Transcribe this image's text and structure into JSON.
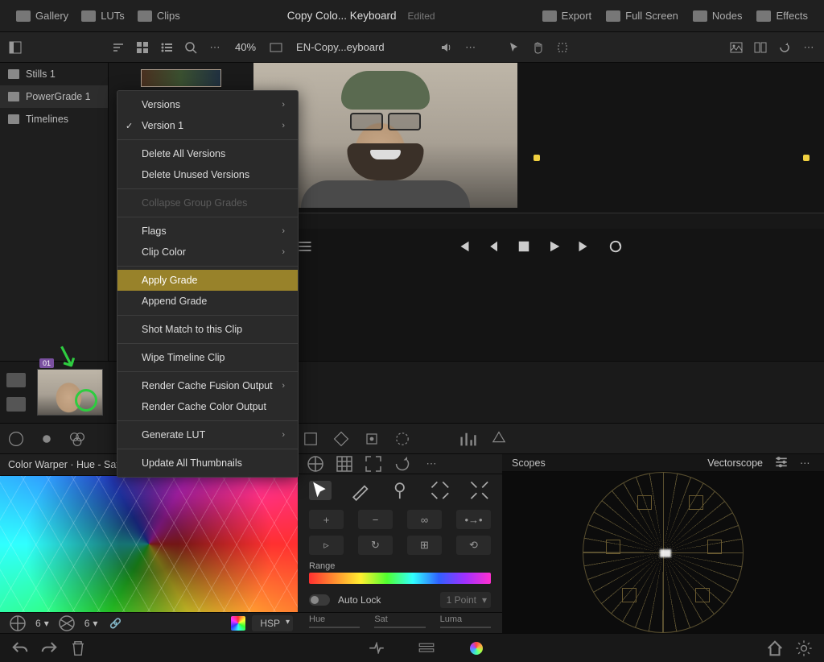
{
  "top": {
    "gallery": "Gallery",
    "luts": "LUTs",
    "clips": "Clips",
    "title": "Copy Colo... Keyboard",
    "edited": "Edited",
    "export": "Export",
    "fullscreen": "Full Screen",
    "nodes": "Nodes",
    "effects": "Effects"
  },
  "toolbar": {
    "zoom": "40%",
    "clipname": "EN-Copy...eyboard"
  },
  "sidebar": {
    "items": [
      {
        "label": "Stills 1"
      },
      {
        "label": "PowerGrade 1"
      },
      {
        "label": "Timelines"
      }
    ]
  },
  "clip": {
    "badge": "01"
  },
  "warper": {
    "title": "Color Warper · Hue - Satu"
  },
  "warper_ctrl": {
    "range_label": "Range",
    "autolock": "Auto Lock",
    "point_sel": "1 Point",
    "sliders": [
      "Hue",
      "Sat",
      "Luma"
    ]
  },
  "scopes": {
    "title": "Scopes",
    "name": "Vectorscope"
  },
  "footer": {
    "num1": "6",
    "num2": "6",
    "mode": "HSP"
  },
  "ctx": {
    "versions": "Versions",
    "version1": "Version 1",
    "delete_all": "Delete All Versions",
    "delete_unused": "Delete Unused Versions",
    "collapse": "Collapse Group Grades",
    "flags": "Flags",
    "clip_color": "Clip Color",
    "apply_grade": "Apply Grade",
    "append_grade": "Append Grade",
    "shot_match": "Shot Match to this Clip",
    "wipe_tl": "Wipe Timeline Clip",
    "cache_fusion": "Render Cache Fusion Output",
    "cache_color": "Render Cache Color Output",
    "gen_lut": "Generate LUT",
    "update_thumbs": "Update All Thumbnails"
  }
}
